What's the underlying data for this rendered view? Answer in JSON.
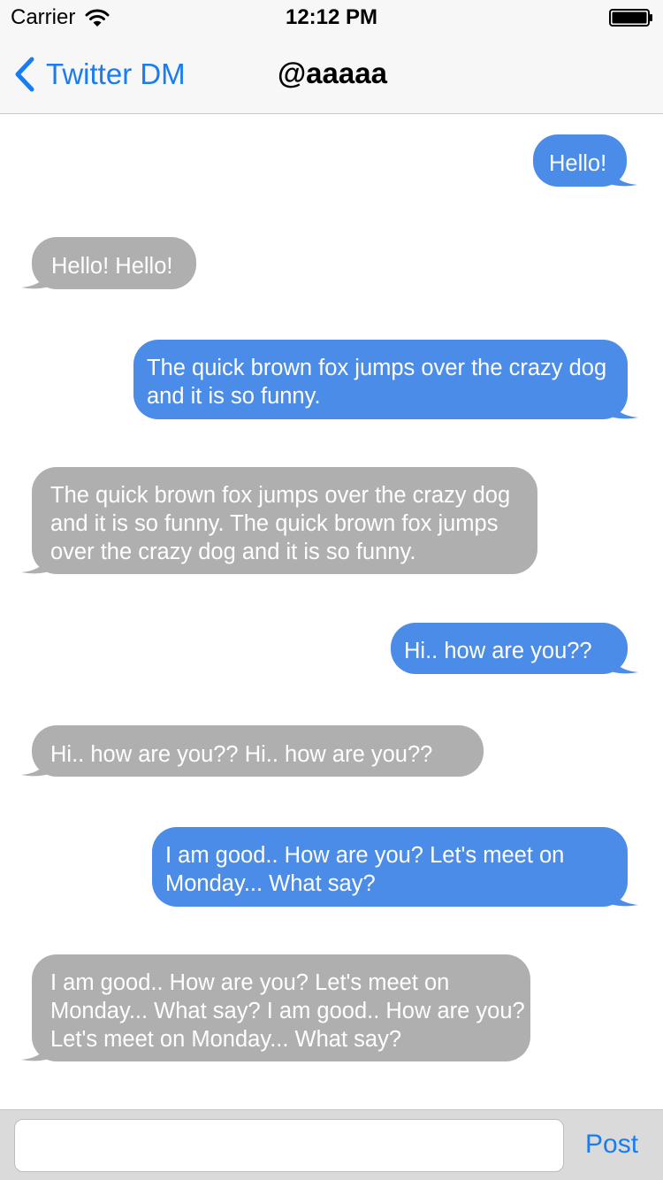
{
  "status_bar": {
    "carrier": "Carrier",
    "time": "12:12 PM"
  },
  "nav": {
    "back_label": "Twitter DM",
    "title": "@aaaaa"
  },
  "colors": {
    "accent": "#1a7cf1",
    "outgoing_bubble": "#4b8ce9",
    "incoming_bubble": "#afafaf"
  },
  "messages": [
    {
      "direction": "outgoing",
      "text": "Hello!"
    },
    {
      "direction": "incoming",
      "text": "Hello! Hello!"
    },
    {
      "direction": "outgoing",
      "text": "The quick brown fox jumps over the crazy dog and it is so funny."
    },
    {
      "direction": "incoming",
      "text": "The quick brown fox jumps over the crazy dog and it is so funny. The quick brown fox jumps over the crazy dog and it is so funny."
    },
    {
      "direction": "outgoing",
      "text": "Hi.. how are you??"
    },
    {
      "direction": "incoming",
      "text": "Hi.. how are you?? Hi.. how are you??"
    },
    {
      "direction": "outgoing",
      "text": "I am good.. How are you? Let's meet on Monday... What say?"
    },
    {
      "direction": "incoming",
      "text": "I am good.. How are you? Let's meet on Monday... What say? I am good.. How are you? Let's meet on Monday... What say?"
    }
  ],
  "composer": {
    "value": "",
    "placeholder": "",
    "post_label": "Post"
  }
}
